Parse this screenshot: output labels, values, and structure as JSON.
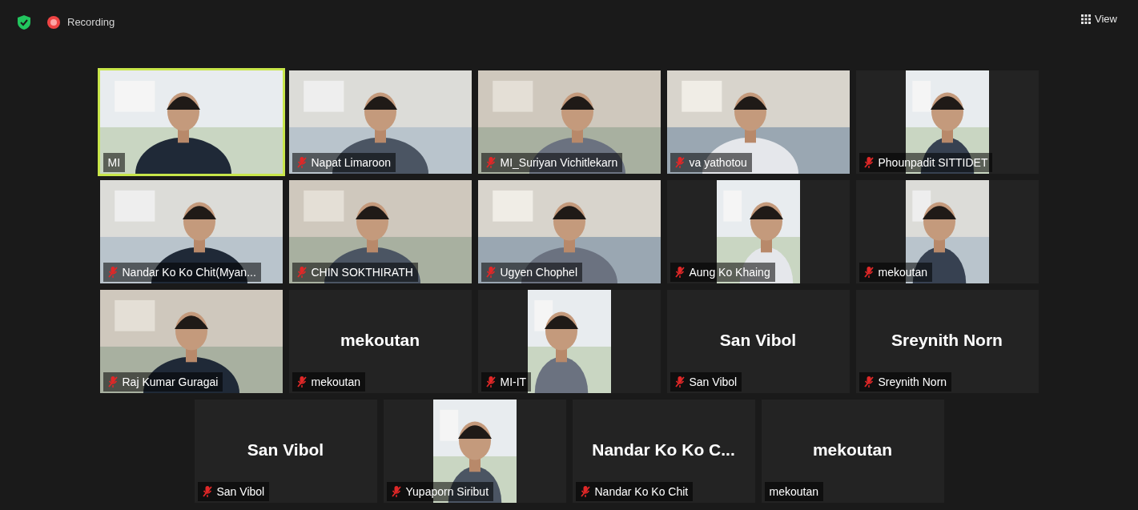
{
  "top_bar": {
    "recording": "Recording",
    "view_button": "View"
  },
  "rows": [
    [
      {
        "kind": "video",
        "speaking": true,
        "name": "MI",
        "muted": false
      },
      {
        "kind": "video",
        "speaking": false,
        "name": "Napat Limaroon",
        "muted": true
      },
      {
        "kind": "video",
        "speaking": false,
        "name": "MI_Suriyan Vichitlekarn",
        "muted": true
      },
      {
        "kind": "video",
        "speaking": false,
        "name": "va yathotou",
        "muted": true
      },
      {
        "kind": "inset",
        "speaking": false,
        "name": "Phounpadit SITTIDET",
        "muted": true
      }
    ],
    [
      {
        "kind": "video",
        "speaking": false,
        "name": "Nandar Ko Ko Chit(Myan...",
        "muted": true
      },
      {
        "kind": "video",
        "speaking": false,
        "name": "CHIN SOKTHIRATH",
        "muted": true
      },
      {
        "kind": "video",
        "speaking": false,
        "name": "Ugyen Chophel",
        "muted": true
      },
      {
        "kind": "inset",
        "speaking": false,
        "name": "Aung Ko Khaing",
        "muted": true
      },
      {
        "kind": "inset",
        "speaking": false,
        "name": "mekoutan",
        "muted": true
      }
    ],
    [
      {
        "kind": "video",
        "speaking": false,
        "name": "Raj Kumar Guragai",
        "muted": true
      },
      {
        "kind": "name",
        "speaking": false,
        "title": "mekoutan",
        "name": "mekoutan",
        "muted": true
      },
      {
        "kind": "inset",
        "speaking": false,
        "name": "MI-IT",
        "muted": true
      },
      {
        "kind": "name",
        "speaking": false,
        "title": "San Vibol",
        "name": "San Vibol",
        "muted": true
      },
      {
        "kind": "name",
        "speaking": false,
        "title": "Sreynith Norn",
        "name": "Sreynith Norn",
        "muted": true
      }
    ],
    [
      {
        "kind": "name",
        "speaking": false,
        "title": "San Vibol",
        "name": "San Vibol",
        "muted": true
      },
      {
        "kind": "inset",
        "speaking": false,
        "name": "Yupaporn Siribut",
        "muted": true
      },
      {
        "kind": "name",
        "speaking": false,
        "title": "Nandar Ko Ko C...",
        "name": "Nandar Ko Ko Chit",
        "muted": true
      },
      {
        "kind": "name",
        "speaking": false,
        "title": "mekoutan",
        "name": "mekoutan",
        "muted": false
      }
    ]
  ]
}
